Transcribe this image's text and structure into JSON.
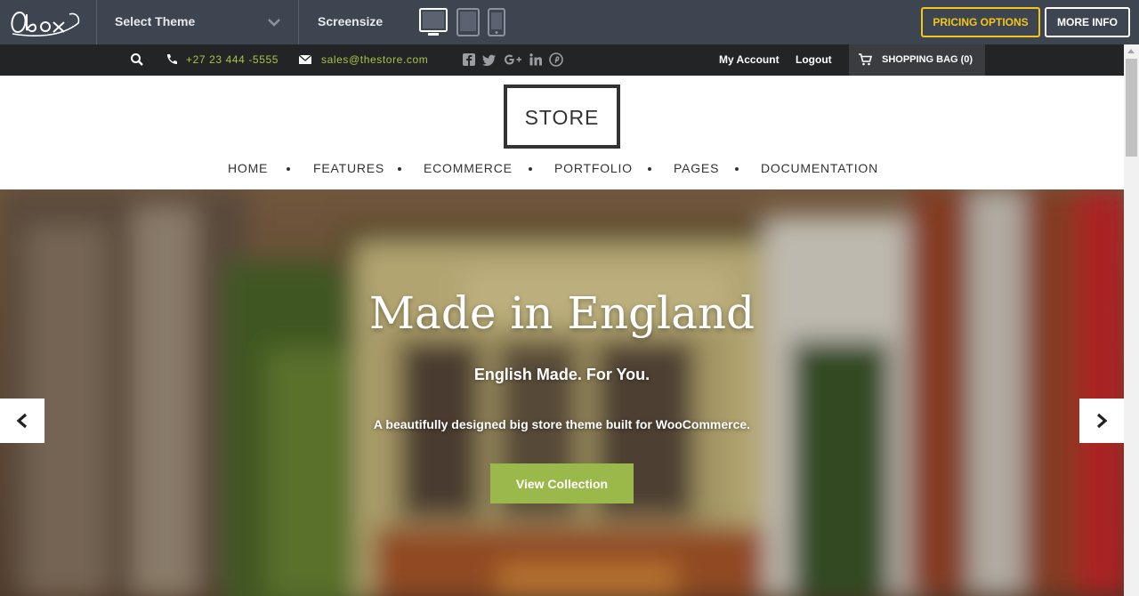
{
  "demo_bar": {
    "logo": "Obox",
    "select_theme_label": "Select Theme",
    "screensize_label": "Screensize",
    "devices": [
      "desktop-icon",
      "tablet-icon",
      "mobile-icon"
    ],
    "pricing_label": "PRICING OPTIONS",
    "more_info_label": "MORE INFO",
    "colors": {
      "bar": "#3d4550",
      "pricing": "#f5c518"
    }
  },
  "topbar": {
    "phone": "+27 23 444 -5555",
    "email": "sales@thestore.com",
    "social": [
      "facebook-icon",
      "twitter-icon",
      "google-plus-icon",
      "linkedin-icon",
      "pinterest-icon"
    ],
    "my_account": "My Account",
    "logout": "Logout",
    "cart_label": "SHOPPING BAG (0)",
    "colors": {
      "accent": "#a8c44a"
    }
  },
  "header": {
    "logo_text": "STORE",
    "nav": [
      "HOME",
      "FEATURES",
      "ECOMMERCE",
      "PORTFOLIO",
      "PAGES",
      "DOCUMENTATION"
    ]
  },
  "hero": {
    "title": "Made in England",
    "subtitle": "English Made. For You.",
    "description": "A beautifully designed big store theme built for WooCommerce.",
    "button_label": "View Collection",
    "colors": {
      "button": "#9bb84a"
    }
  }
}
